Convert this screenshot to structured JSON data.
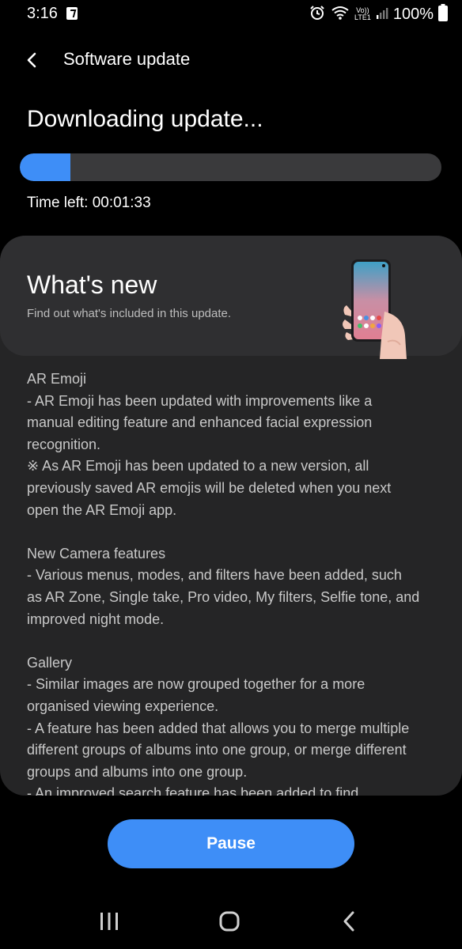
{
  "status_bar": {
    "time": "3:16",
    "icons": [
      "notification-icon",
      "alarm-icon",
      "wifi-icon",
      "volte-icon",
      "signal-icon",
      "battery-icon"
    ],
    "volte_label_top": "Vo))",
    "volte_label_bottom": "LTE1",
    "battery_percent": "100%"
  },
  "header": {
    "back_icon": "chevron-left-icon",
    "title": "Software update"
  },
  "download": {
    "title": "Downloading update...",
    "progress_percent": 12,
    "time_left": "Time left: 00:01:33",
    "accent_color": "#3e8ef7",
    "track_color": "#3a3a3c"
  },
  "whats_new": {
    "title": "What's new",
    "subtitle": "Find out what's included in this update.",
    "illustration": "phone-in-hand-illustration",
    "sections": [
      {
        "lines": [
          "AR Emoji",
          "- AR Emoji has been updated with improvements like a",
          "manual editing feature and enhanced facial expression",
          "recognition.",
          "※ As AR Emoji has been updated to a new version, all",
          "previously saved AR emojis will be deleted when you next",
          "open the AR Emoji app."
        ]
      },
      {
        "lines": [
          "New Camera features",
          "- Various menus, modes, and filters have been added, such",
          "as AR Zone, Single take, Pro video, My filters, Selfie tone, and",
          "improved night mode."
        ]
      },
      {
        "lines": [
          "Gallery",
          "- Similar images are now grouped together for a more",
          "organised viewing experience.",
          "- A feature has been added that allows you to merge multiple",
          "different groups of albums into one group, or merge different",
          "groups and albums into one group.",
          "- An improved search feature has been added to find"
        ]
      }
    ]
  },
  "actions": {
    "pause_label": "Pause"
  },
  "nav_bar": {
    "icons": [
      "recent-apps-icon",
      "home-icon",
      "back-icon"
    ]
  }
}
